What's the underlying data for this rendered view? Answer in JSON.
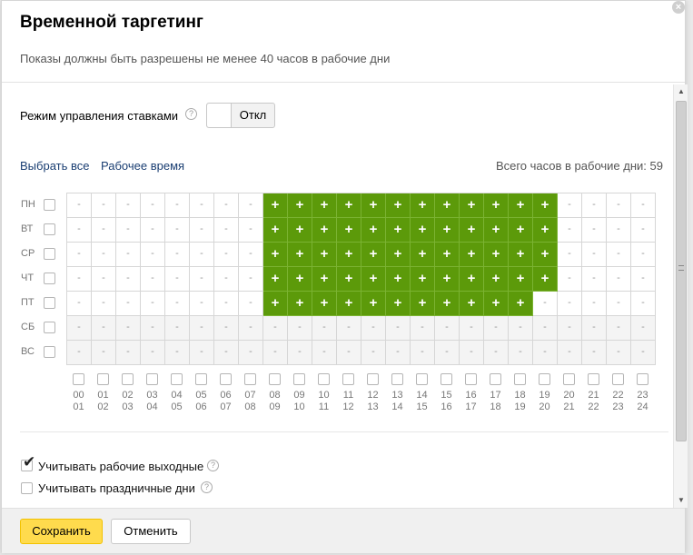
{
  "dialog": {
    "title": "Временной таргетинг",
    "subtitle": "Показы должны быть разрешены не менее 40 часов в рабочие дни"
  },
  "bid_mode": {
    "label": "Режим управления ставками",
    "toggle_state": "Откл"
  },
  "actions": {
    "select_all": "Выбрать все",
    "work_time": "Рабочее время",
    "total_hours_label": "Всего часов в рабочие дни: 59"
  },
  "schedule": {
    "days": [
      {
        "label": "ПН",
        "on_from": 8,
        "on_to": 20,
        "weekend": false
      },
      {
        "label": "ВТ",
        "on_from": 8,
        "on_to": 20,
        "weekend": false
      },
      {
        "label": "СР",
        "on_from": 8,
        "on_to": 20,
        "weekend": false
      },
      {
        "label": "ЧТ",
        "on_from": 8,
        "on_to": 20,
        "weekend": false
      },
      {
        "label": "ПТ",
        "on_from": 8,
        "on_to": 19,
        "weekend": false
      },
      {
        "label": "СБ",
        "on_from": null,
        "on_to": null,
        "weekend": true
      },
      {
        "label": "ВС",
        "on_from": null,
        "on_to": null,
        "weekend": true
      }
    ],
    "on_symbol": "+",
    "off_symbol": "-",
    "hours": [
      {
        "from": "00",
        "to": "01"
      },
      {
        "from": "01",
        "to": "02"
      },
      {
        "from": "02",
        "to": "03"
      },
      {
        "from": "03",
        "to": "04"
      },
      {
        "from": "04",
        "to": "05"
      },
      {
        "from": "05",
        "to": "06"
      },
      {
        "from": "06",
        "to": "07"
      },
      {
        "from": "07",
        "to": "08"
      },
      {
        "from": "08",
        "to": "09"
      },
      {
        "from": "09",
        "to": "10"
      },
      {
        "from": "10",
        "to": "11"
      },
      {
        "from": "11",
        "to": "12"
      },
      {
        "from": "12",
        "to": "13"
      },
      {
        "from": "13",
        "to": "14"
      },
      {
        "from": "14",
        "to": "15"
      },
      {
        "from": "15",
        "to": "16"
      },
      {
        "from": "16",
        "to": "17"
      },
      {
        "from": "17",
        "to": "18"
      },
      {
        "from": "18",
        "to": "19"
      },
      {
        "from": "19",
        "to": "20"
      },
      {
        "from": "20",
        "to": "21"
      },
      {
        "from": "21",
        "to": "22"
      },
      {
        "from": "22",
        "to": "23"
      },
      {
        "from": "23",
        "to": "24"
      }
    ]
  },
  "options": {
    "working_weekends": {
      "label": "Учитывать рабочие выходные",
      "checked": true
    },
    "holidays": {
      "label": "Учитывать праздничные дни",
      "checked": false
    }
  },
  "footer": {
    "save": "Сохранить",
    "cancel": "Отменить"
  },
  "colors": {
    "active_cell": "#5c9a0a",
    "save_button": "#ffdb4d"
  }
}
